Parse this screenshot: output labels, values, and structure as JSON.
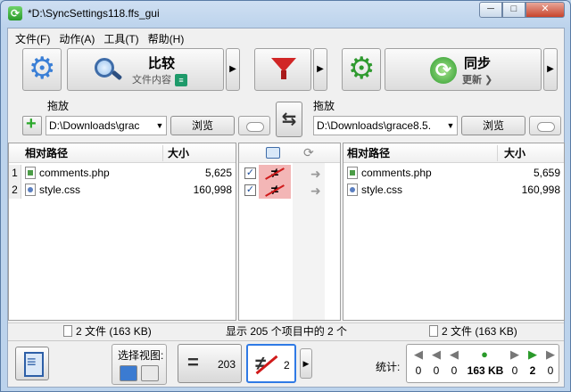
{
  "window": {
    "title": "*D:\\SyncSettings118.ffs_gui",
    "min_label": "─",
    "max_label": "□",
    "close_label": "✕"
  },
  "menu": [
    "文件(F)",
    "动作(A)",
    "工具(T)",
    "帮助(H)"
  ],
  "toolbar": {
    "compare_title": "比较",
    "compare_sub": "文件内容",
    "sync_title": "同步",
    "sync_sub": "更新 ❯",
    "arrow": "▶"
  },
  "left_folder": {
    "drop_label": "拖放",
    "path": "D:\\Downloads\\grac",
    "browse": "浏览"
  },
  "right_folder": {
    "drop_label": "拖放",
    "path": "D:\\Downloads\\grace8.5.",
    "browse": "浏览"
  },
  "left_grid": {
    "col_path": "相对路径",
    "col_size": "大小",
    "rows": [
      {
        "num": "1",
        "name": "comments.php",
        "size": "5,625",
        "type": "php"
      },
      {
        "num": "2",
        "name": "style.css",
        "size": "160,998",
        "type": "css"
      }
    ]
  },
  "right_grid": {
    "col_path": "相对路径",
    "col_size": "大小",
    "rows": [
      {
        "name": "comments.php",
        "size": "5,659",
        "type": "php"
      },
      {
        "name": "style.css",
        "size": "160,998",
        "type": "css"
      }
    ]
  },
  "middle": {
    "rows": [
      {
        "checked": "✓",
        "cmp": "≠",
        "action": "➜"
      },
      {
        "checked": "✓",
        "cmp": "≠",
        "action": "➜"
      }
    ]
  },
  "statusbar": {
    "left": "2 文件 (163 KB)",
    "center": "显示 205 个项目中的 2 个",
    "right": "2 文件 (163 KB)"
  },
  "bottom": {
    "view_label": "选择视图:",
    "equal_count": "203",
    "diff_count": "2",
    "stats_label": "统计:",
    "stats": [
      "0",
      "0",
      "0",
      "163 KB",
      "0",
      "2",
      "0"
    ]
  }
}
